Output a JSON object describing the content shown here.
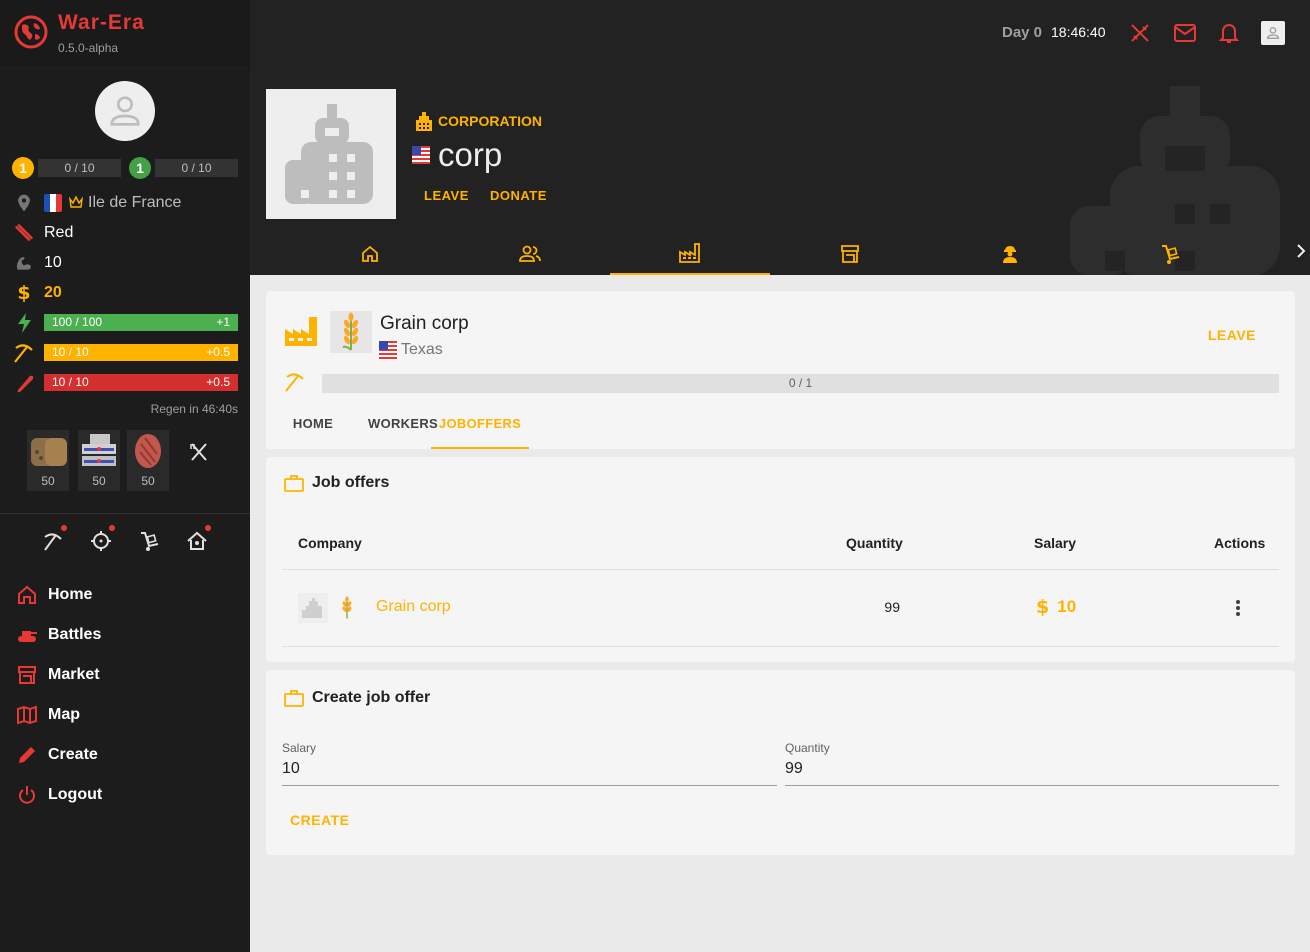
{
  "brand": {
    "name": "War-Era",
    "version": "0.5.0-alpha"
  },
  "player": {
    "level1": {
      "badge": "1",
      "progress": "0 / 10",
      "color": "#ffb300"
    },
    "level2": {
      "badge": "1",
      "progress": "0 / 10",
      "color": "#43a047"
    },
    "location": "Ile de France",
    "party": "Red",
    "strength": "10",
    "money": "20",
    "energy": {
      "value": "100 / 100",
      "regen": "+1",
      "color": "#4caf50"
    },
    "work": {
      "value": "10 / 10",
      "regen": "+0.5",
      "color": "#ffb300"
    },
    "health": {
      "value": "10 / 10",
      "regen": "+0.5",
      "color": "#e53935"
    },
    "regen_text": "Regen in 46:40s",
    "food": [
      {
        "name": "bread",
        "qty": "50"
      },
      {
        "name": "fish-can",
        "qty": "50"
      },
      {
        "name": "steak",
        "qty": "50"
      }
    ]
  },
  "nav": [
    {
      "id": "home",
      "label": "Home"
    },
    {
      "id": "battles",
      "label": "Battles"
    },
    {
      "id": "market",
      "label": "Market"
    },
    {
      "id": "map",
      "label": "Map"
    },
    {
      "id": "create",
      "label": "Create"
    },
    {
      "id": "logout",
      "label": "Logout"
    }
  ],
  "header": {
    "day": "Day 0",
    "time": "18:46:40"
  },
  "corporation": {
    "type": "CORPORATION",
    "name": "corp",
    "leave": "LEAVE",
    "donate": "DONATE"
  },
  "company": {
    "name": "Grain corp",
    "region": "Texas",
    "leave": "LEAVE",
    "progress": "0 / 1",
    "tabs": [
      "HOME",
      "WORKERS",
      "JOBOFFERS"
    ],
    "active_tab": "JOBOFFERS"
  },
  "job_offers": {
    "title": "Job offers",
    "columns": {
      "company": "Company",
      "quantity": "Quantity",
      "salary": "Salary",
      "actions": "Actions"
    },
    "rows": [
      {
        "company": "Grain corp",
        "quantity": "99",
        "salary": "10"
      }
    ]
  },
  "create_offer": {
    "title": "Create job offer",
    "salary_label": "Salary",
    "salary_value": "10",
    "quantity_label": "Quantity",
    "quantity_value": "99",
    "button": "CREATE"
  },
  "colors": {
    "accent": "#ffb300",
    "danger": "#e53935",
    "sidebar": "#1c1c1c",
    "header": "#222222"
  }
}
